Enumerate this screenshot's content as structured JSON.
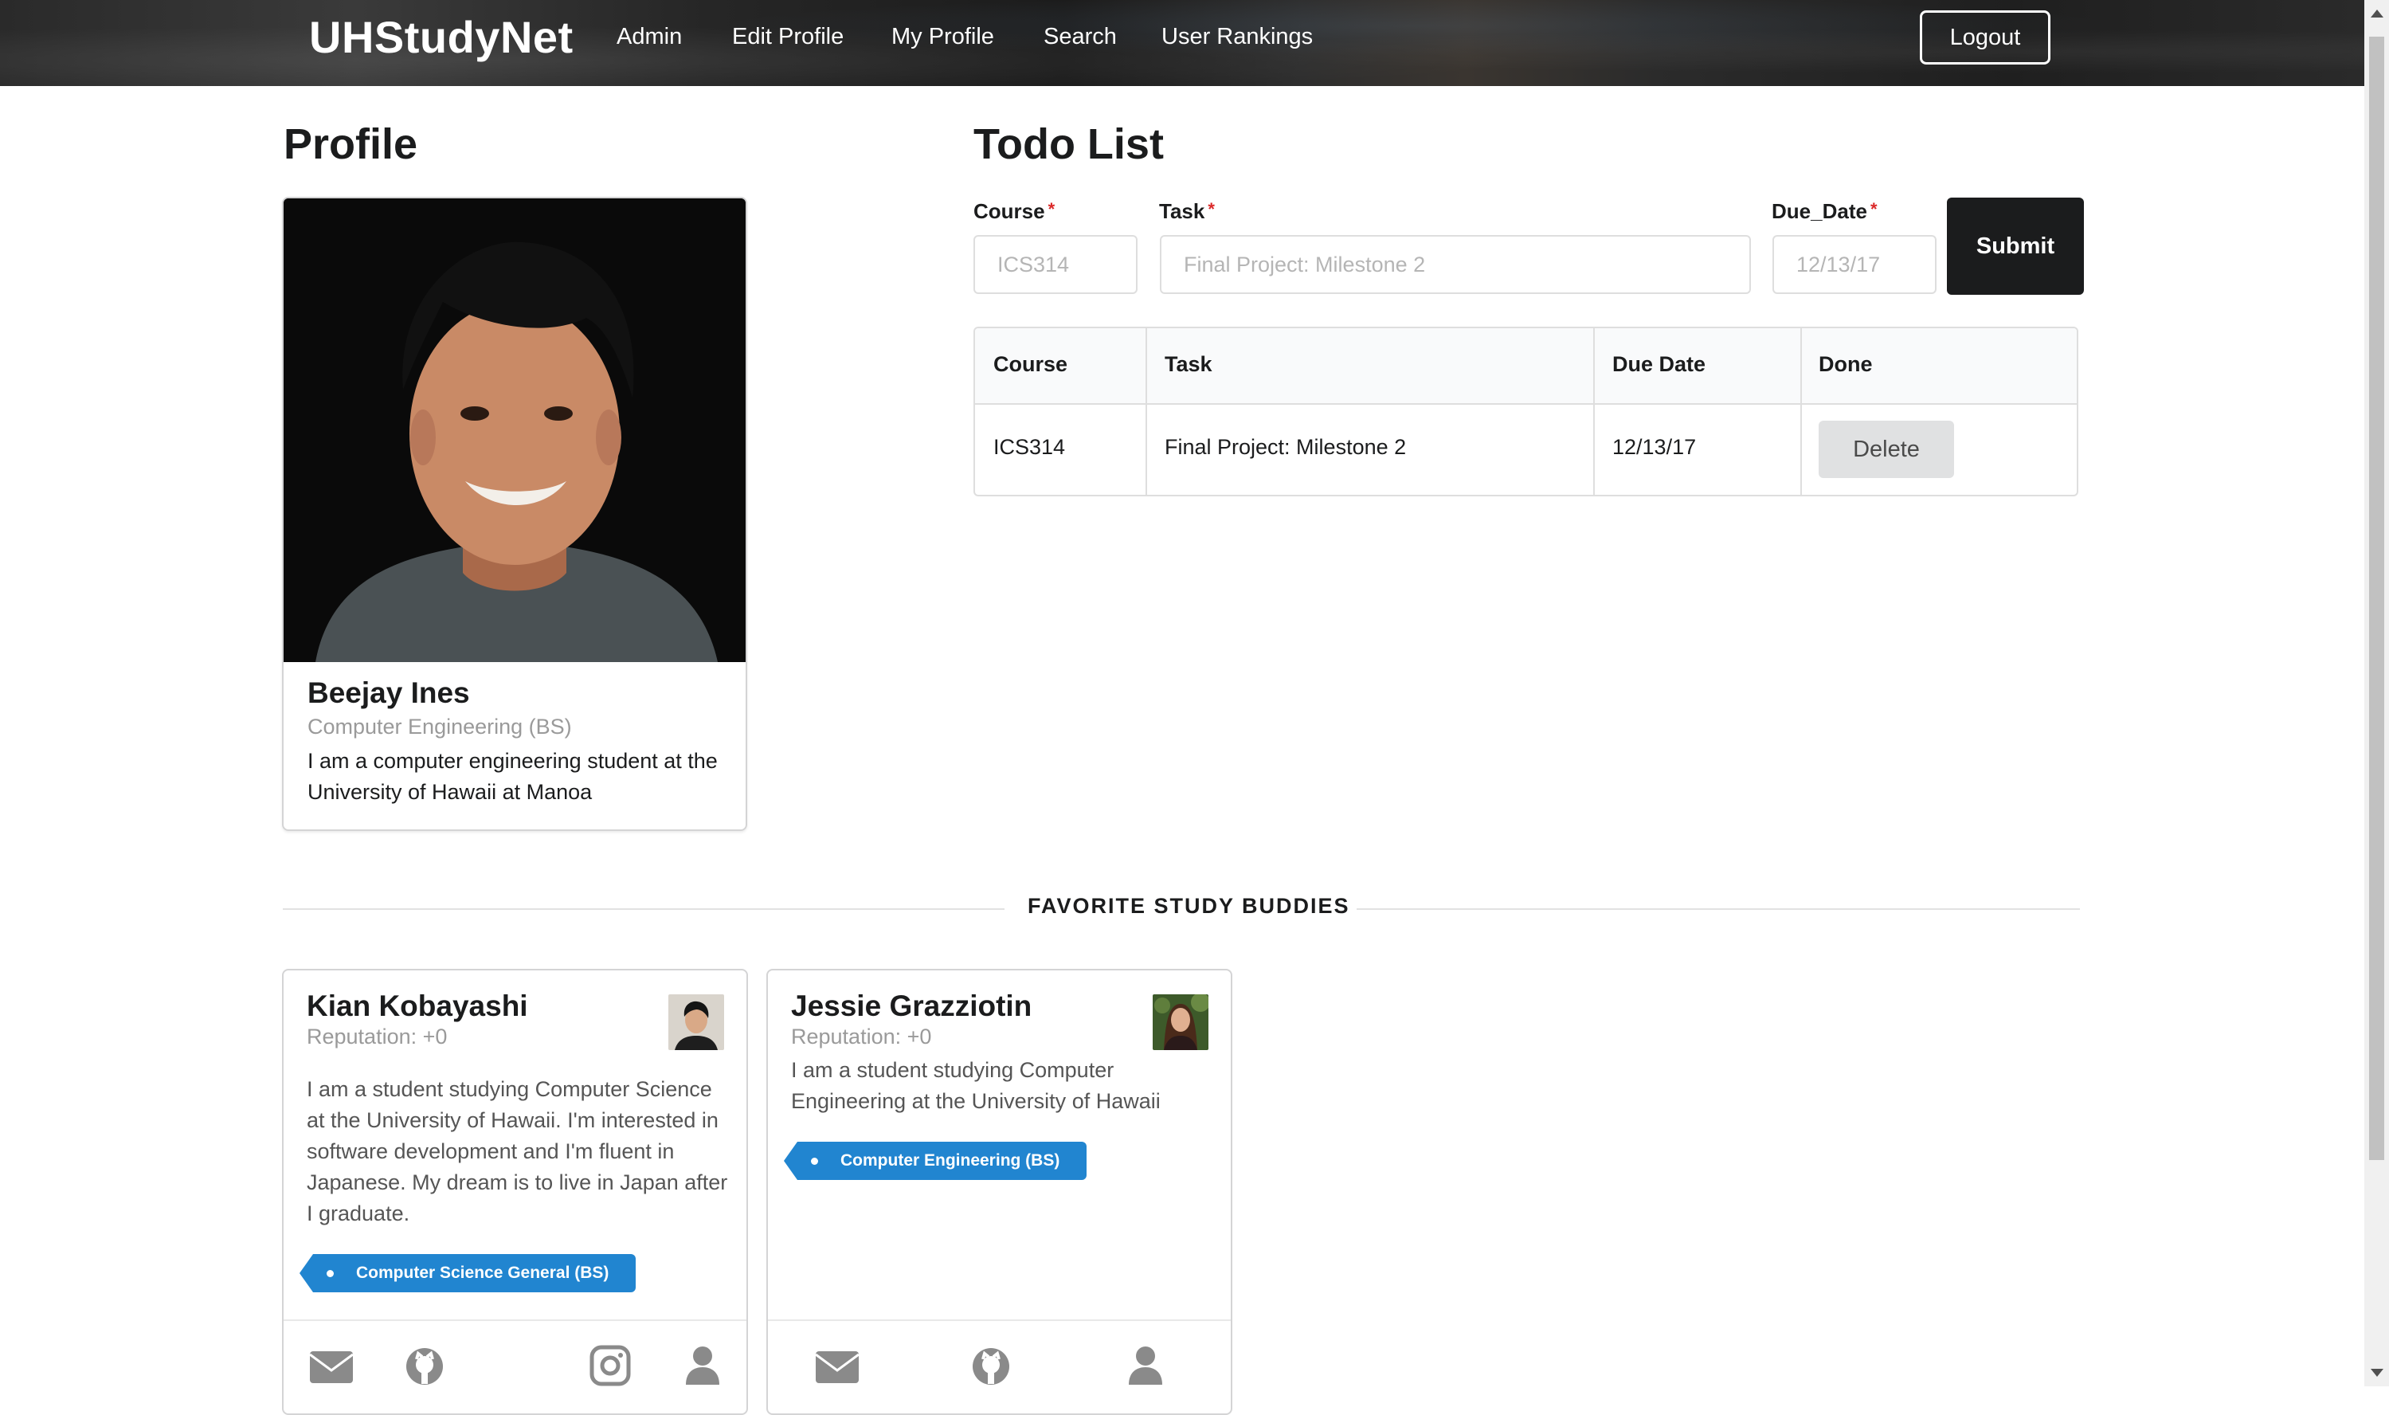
{
  "nav": {
    "brand": "UHStudyNet",
    "items": [
      "Admin",
      "Edit Profile",
      "My Profile",
      "Search",
      "User Rankings"
    ],
    "logout": "Logout"
  },
  "profile": {
    "title": "Profile",
    "name": "Beejay Ines",
    "major": "Computer Engineering (BS)",
    "description": "I am a computer engineering student at the University of Hawaii at Manoa"
  },
  "todo": {
    "title": "Todo List",
    "form": {
      "course_label": "Course",
      "task_label": "Task",
      "due_label": "Due_Date",
      "required_mark": "*",
      "course_placeholder": "ICS314",
      "task_placeholder": "Final Project: Milestone 2",
      "due_placeholder": "12/13/17",
      "submit": "Submit"
    },
    "table": {
      "headers": [
        "Course",
        "Task",
        "Due Date",
        "Done"
      ],
      "rows": [
        {
          "course": "ICS314",
          "task": "Final Project: Milestone 2",
          "due": "12/13/17",
          "action": "Delete"
        }
      ]
    }
  },
  "divider": "FAVORITE STUDY BUDDIES",
  "buddies": [
    {
      "name": "Kian Kobayashi",
      "reputation": "Reputation: +0",
      "description": "I am a student studying Computer Science at the University of Hawaii. I'm interested in software development and I'm fluent in Japanese. My dream is to live in Japan after I graduate.",
      "tag": "Computer Science General (BS)",
      "icons": [
        "mail-icon",
        "github-icon",
        "instagram-icon",
        "user-icon"
      ]
    },
    {
      "name": "Jessie Grazziotin",
      "reputation": "Reputation: +0",
      "description": "I am a student studying Computer Engineering at the University of Hawaii",
      "tag": "Computer Engineering (BS)",
      "icons": [
        "mail-icon",
        "github-icon",
        "user-icon"
      ]
    }
  ],
  "colors": {
    "accent": "#2185d0",
    "submit_bg": "#1b1c1d",
    "required": "#db2828"
  }
}
